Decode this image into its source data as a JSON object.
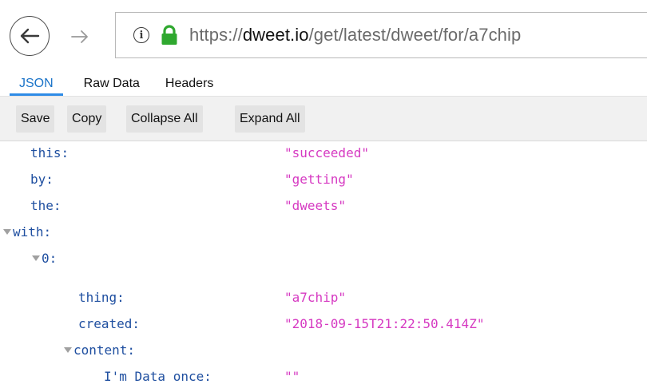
{
  "browser": {
    "url_prefix": "https://",
    "url_host": "dweet.io",
    "url_path": "/get/latest/dweet/for/a7chip",
    "info_glyph": "i"
  },
  "tabs": [
    {
      "label": "JSON",
      "active": true
    },
    {
      "label": "Raw Data",
      "active": false
    },
    {
      "label": "Headers",
      "active": false
    }
  ],
  "toolbar": {
    "save": "Save",
    "copy": "Copy",
    "collapse_all": "Collapse All",
    "expand_all": "Expand All"
  },
  "json_tree": {
    "this_key": "this:",
    "this_val": "\"succeeded\"",
    "by_key": "by:",
    "by_val": "\"getting\"",
    "the_key": "the:",
    "the_val": "\"dweets\"",
    "with_key": "with:",
    "zero_key": "0:",
    "thing_key": "thing:",
    "thing_val": "\"a7chip\"",
    "created_key": "created:",
    "created_val": "\"2018-09-15T21:22:50.414Z\"",
    "content_key": "content:",
    "data_key": "I'm Data once:",
    "data_val": "\"\""
  },
  "colors": {
    "key": "#1f4fa0",
    "string_value": "#d63ac2",
    "active_tab": "#2e8be6",
    "lock": "#2fa82f"
  },
  "icons": [
    "back-arrow-icon",
    "forward-arrow-icon",
    "info-icon",
    "lock-icon",
    "expand-triangle-icon"
  ]
}
